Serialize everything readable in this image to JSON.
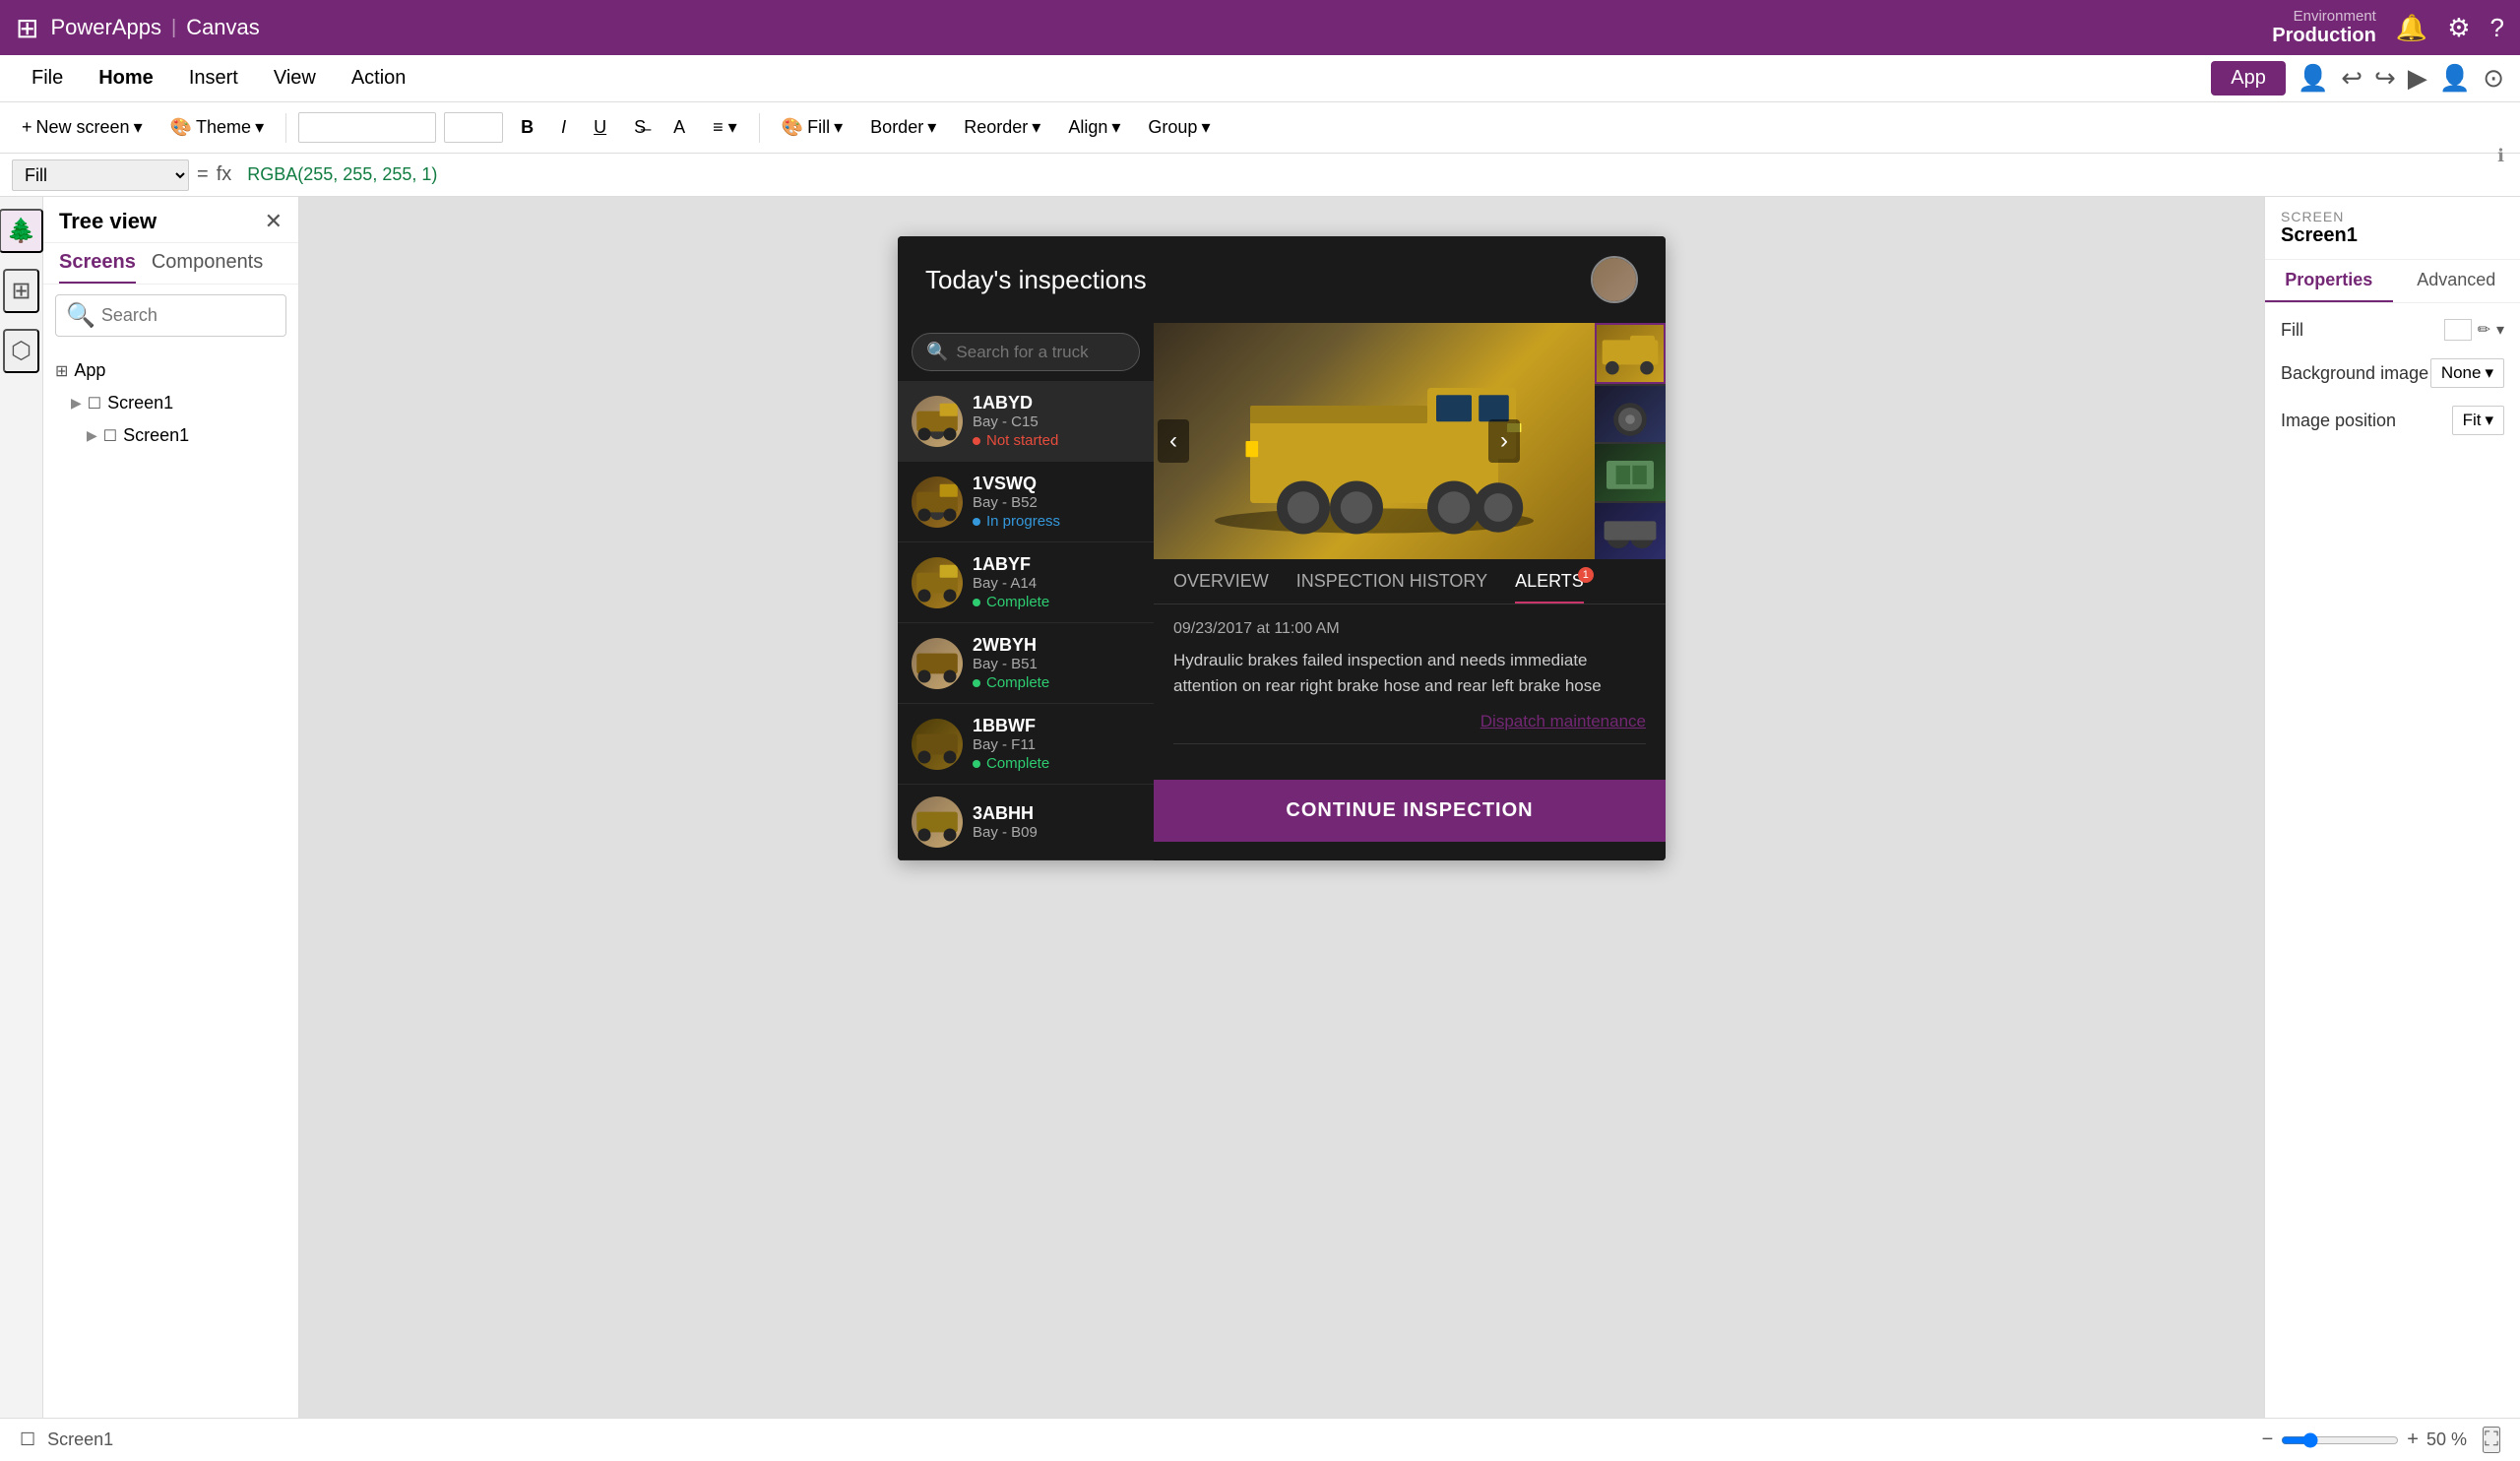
{
  "titlebar": {
    "app_name": "PowerApps",
    "separator": "|",
    "canvas_label": "Canvas",
    "env_label": "Environment",
    "env_name": "Production"
  },
  "menubar": {
    "items": [
      "File",
      "Home",
      "Insert",
      "View",
      "Action"
    ],
    "active_item": "Home",
    "right_buttons": [
      "App"
    ]
  },
  "toolbar": {
    "new_screen_label": "New screen",
    "theme_label": "Theme",
    "bold": "B",
    "italic": "I",
    "underline": "U",
    "strikethrough": "S",
    "font_color": "A",
    "align": "≡",
    "fill_label": "Fill",
    "border_label": "Border",
    "reorder_label": "Reorder",
    "align_label": "Align",
    "group_label": "Group"
  },
  "formula_bar": {
    "property": "Fill",
    "formula": "RGBA(255, 255, 255, 1)"
  },
  "sidebar": {
    "title": "Tree view",
    "tabs": [
      "Screens",
      "Components"
    ],
    "search_placeholder": "Search",
    "items": [
      {
        "label": "App",
        "type": "app"
      },
      {
        "label": "Screen1",
        "type": "screen",
        "level": 1
      },
      {
        "label": "Screen1",
        "type": "screen",
        "level": 2
      }
    ]
  },
  "app": {
    "header": {
      "title": "Today's inspections"
    },
    "search_placeholder": "Search for a truck",
    "trucks": [
      {
        "id": "1ABYD",
        "bay": "Bay - C15",
        "status": "Not started",
        "status_type": "red"
      },
      {
        "id": "1VSWQ",
        "bay": "Bay - B52",
        "status": "In progress",
        "status_type": "blue"
      },
      {
        "id": "1ABYF",
        "bay": "Bay - A14",
        "status": "Complete",
        "status_type": "green"
      },
      {
        "id": "2WBYH",
        "bay": "Bay - B51",
        "status": "Complete",
        "status_type": "green"
      },
      {
        "id": "1BBWF",
        "bay": "Bay - F11",
        "status": "Complete",
        "status_type": "green"
      },
      {
        "id": "3ABHH",
        "bay": "Bay - B09",
        "status": "",
        "status_type": "green"
      }
    ],
    "detail": {
      "tabs": [
        "OVERVIEW",
        "INSPECTION HISTORY",
        "ALERTS"
      ],
      "active_tab": "ALERTS",
      "alert_badge": "1",
      "alert_date": "09/23/2017 at 11:00 AM",
      "alert_text": "Hydraulic brakes failed inspection and needs immediate attention on rear right brake hose and rear left brake hose",
      "dispatch_link": "Dispatch maintenance",
      "continue_btn": "CONTINUE INSPECTION"
    }
  },
  "properties": {
    "screen_label": "SCREEN",
    "screen_name": "Screen1",
    "tabs": [
      "Properties",
      "Advanced"
    ],
    "active_tab": "Properties",
    "rows": [
      {
        "label": "Fill",
        "value": "",
        "type": "color"
      },
      {
        "label": "Background image",
        "value": "None"
      },
      {
        "label": "Image position",
        "value": "Fit"
      }
    ]
  },
  "bottombar": {
    "screen_name": "Screen1",
    "zoom_minus": "−",
    "zoom_plus": "+",
    "zoom_percent": "50 %"
  }
}
